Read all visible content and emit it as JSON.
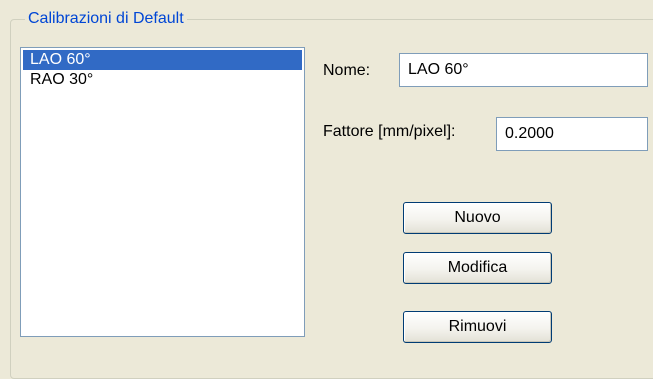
{
  "group": {
    "title": "Calibrazioni di Default"
  },
  "list": {
    "items": [
      {
        "label": "LAO 60°",
        "selected": true
      },
      {
        "label": "RAO 30°",
        "selected": false
      }
    ]
  },
  "form": {
    "nome_label": "Nome:",
    "nome_value": "LAO 60°",
    "fattore_label": "Fattore [mm/pixel]:",
    "fattore_value": "0.2000"
  },
  "buttons": {
    "nuovo": "Nuovo",
    "modifica": "Modifica",
    "rimuovi": "Rimuovi"
  },
  "colors": {
    "window_bg": "#ECE9D8",
    "legend_text": "#0046D5",
    "selection_bg": "#316AC5",
    "field_border": "#7F9DB9",
    "button_border": "#003C74"
  }
}
